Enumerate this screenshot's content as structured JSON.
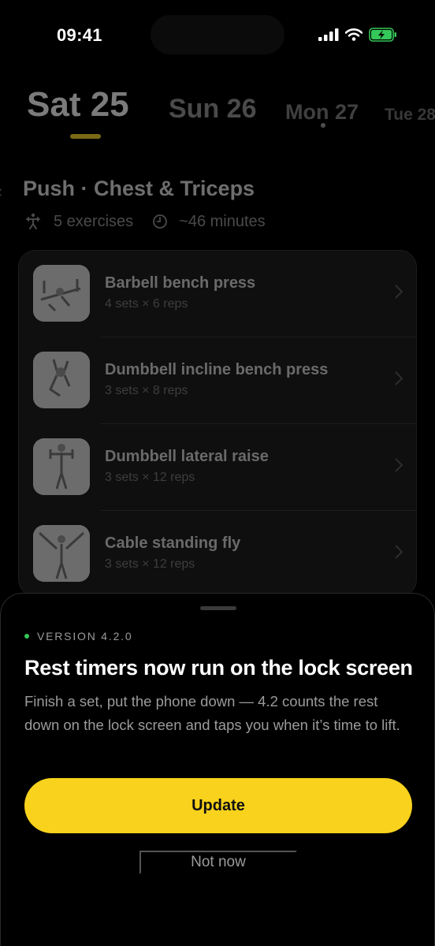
{
  "status_bar": {
    "time": "09:41",
    "icons": [
      "cellular-signal-icon",
      "wifi-icon",
      "battery-charging-icon"
    ],
    "battery_color": "#34c759"
  },
  "day_strip": {
    "days": [
      {
        "label": "Sat 25",
        "selected": true
      },
      {
        "label": "Sun 26",
        "selected": false
      },
      {
        "label": "Mon 27",
        "selected": false,
        "has_dot": true
      },
      {
        "label": "Tue 28",
        "selected": false
      }
    ],
    "accent": "#f8d21c"
  },
  "workout": {
    "title": "Push · Chest & Triceps",
    "exercise_count": "5 exercises",
    "duration": "~46 minutes",
    "exercises": [
      {
        "name": "Barbell bench press",
        "sets": "4 sets × 6 reps"
      },
      {
        "name": "Dumbbell incline bench press",
        "sets": "3 sets × 8 reps"
      },
      {
        "name": "Dumbbell lateral raise",
        "sets": "3 sets × 12 reps"
      },
      {
        "name": "Cable standing fly",
        "sets": "3 sets × 12 reps"
      }
    ]
  },
  "update_sheet": {
    "version_label": "VERSION 4.2.0",
    "headline": "Rest timers now run on the lock screen",
    "body": "Finish a set, put the phone down — 4.2 counts the rest down on the lock screen and taps you when it’s time to lift.",
    "primary_button": "Update",
    "secondary_button": "Not now",
    "accent": "#f8d21c",
    "status_dot_color": "#34c759"
  }
}
